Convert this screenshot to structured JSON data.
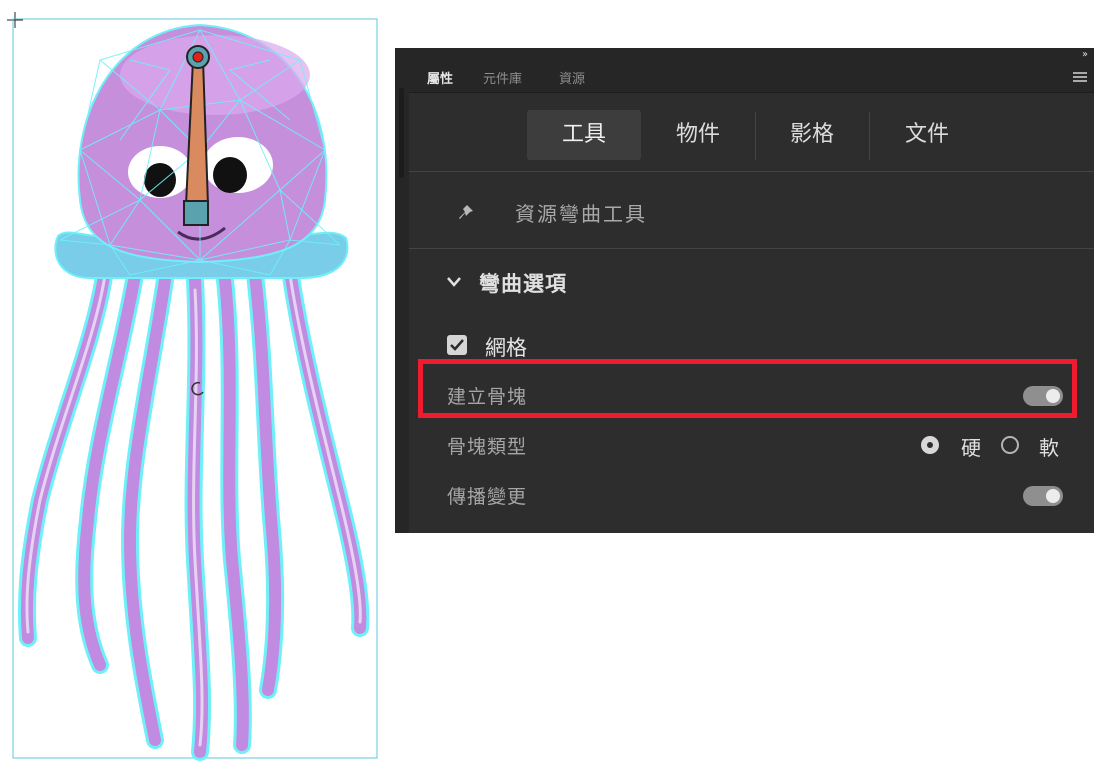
{
  "panel": {
    "tabs": [
      {
        "label": "屬性",
        "active": true
      },
      {
        "label": "元件庫",
        "active": false
      },
      {
        "label": "資源",
        "active": false
      }
    ],
    "collapse_glyph": "››",
    "menu_icon": "hamburger-icon",
    "segments": [
      {
        "label": "工具",
        "active": true
      },
      {
        "label": "物件",
        "active": false
      },
      {
        "label": "影格",
        "active": false
      },
      {
        "label": "文件",
        "active": false
      }
    ],
    "tool": {
      "icon": "pin-icon",
      "name": "資源彎曲工具"
    },
    "section": {
      "icon": "chevron-down-icon",
      "title": "彎曲選項"
    },
    "mesh": {
      "label": "網格",
      "checked": true
    },
    "create_bones": {
      "label": "建立骨塊",
      "on": true
    },
    "bone_type": {
      "label": "骨塊類型",
      "options": [
        {
          "label": "硬",
          "selected": true
        },
        {
          "label": "軟",
          "selected": false
        }
      ]
    },
    "propagate": {
      "label": "傳播變更",
      "on": true
    }
  },
  "colors": {
    "panel_bg": "#2d2d2d",
    "highlight": "#ee1c2e",
    "mesh_lines": "#6ff0f8",
    "jelly_body": "#c58fdc",
    "jelly_skirt": "#79cde8",
    "bone": "#d98a5e",
    "bone_handle": "#5aa2ae",
    "bone_joint": "#e2231a"
  }
}
